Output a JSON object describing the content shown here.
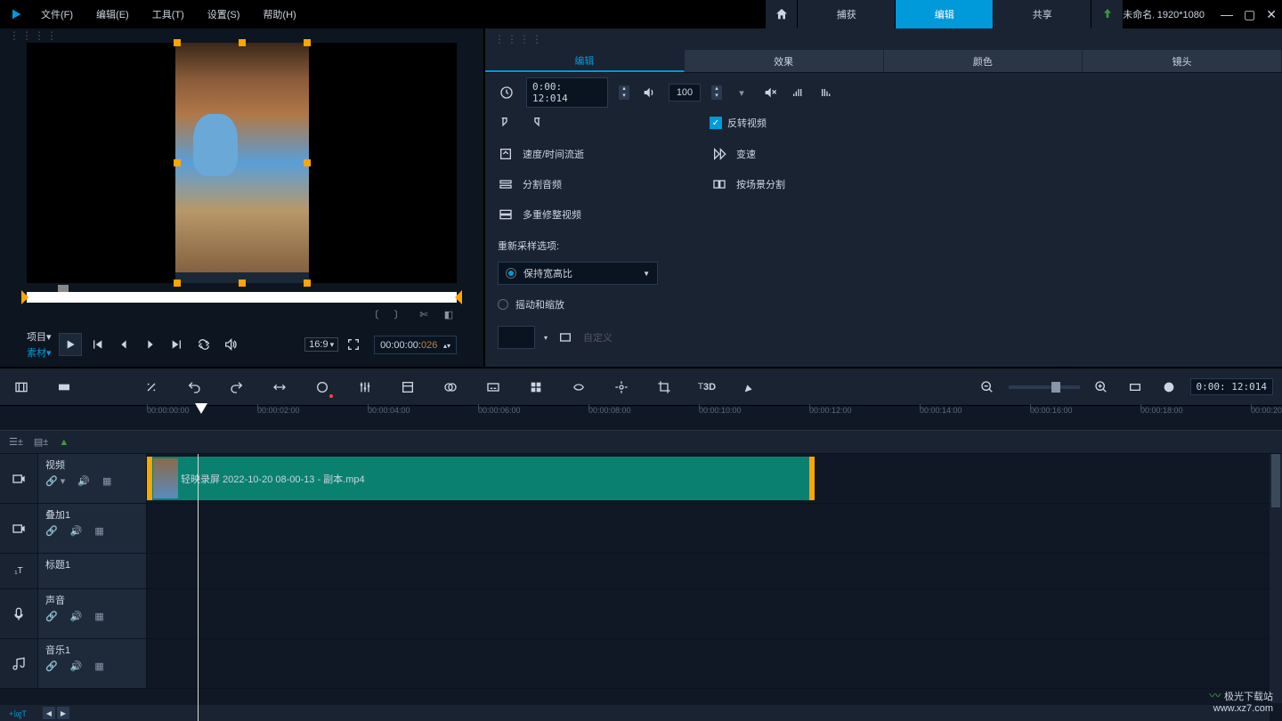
{
  "project": {
    "name": "未命名",
    "resolution": "1920*1080"
  },
  "menubar": [
    "文件(F)",
    "编辑(E)",
    "工具(T)",
    "设置(S)",
    "帮助(H)"
  ],
  "main_tabs": {
    "capture": "捕获",
    "edit": "编辑",
    "share": "共享"
  },
  "preview": {
    "mode_project": "项目▾",
    "mode_clip": "素材▾",
    "aspect": "16:9",
    "timecode_main": "00:00:00:",
    "timecode_frames": "026"
  },
  "edit_tabs": [
    "编辑",
    "效果",
    "颜色",
    "镜头"
  ],
  "edit_panel": {
    "time": "0:00: 12:014",
    "volume": "100",
    "reverse": "反转视频",
    "tools": {
      "speed": "速度/时间流逝",
      "varispeed": "变速",
      "split_audio": "分割音频",
      "scene_split": "按场景分割",
      "multi_trim": "多重修整视频"
    },
    "resample_label": "重新采样选项:",
    "keep_aspect": "保持宽高比",
    "pan_zoom": "摇动和缩放",
    "custom": "自定义"
  },
  "ruler_ticks": [
    "00:00:00:00",
    "00:00:02:00",
    "00:00:04:00",
    "00:00:06:00",
    "00:00:08:00",
    "00:00:10:00",
    "00:00:12:00",
    "00:00:14:00",
    "00:00:16:00",
    "00:00:18:00",
    "00:00:20"
  ],
  "tracks": {
    "video": "视频",
    "overlay": "叠加1",
    "title": "标题1",
    "voice": "声音",
    "music": "音乐1"
  },
  "clip": {
    "name": "轻映录屏 2022-10-20 08-00-13 - 副本.mp4"
  },
  "tl_time": "0:00: 12:014",
  "hscroll_btn": "+㏒T",
  "watermark": {
    "brand": "极光下载站",
    "url": "www.xz7.com"
  }
}
